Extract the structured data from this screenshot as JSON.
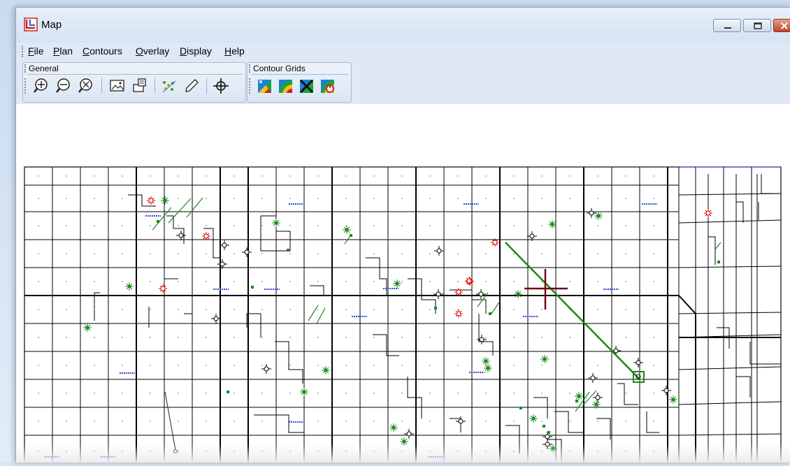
{
  "window": {
    "title": "Map"
  },
  "menu": [
    {
      "label": "File",
      "underline": "F",
      "rest": "ile"
    },
    {
      "label": "Plan",
      "underline": "P",
      "rest": "lan"
    },
    {
      "label": "Contours",
      "underline": "C",
      "rest": "ontours"
    },
    {
      "label": "Overlay",
      "underline": "O",
      "rest": "verlay"
    },
    {
      "label": "Display",
      "underline": "D",
      "rest": "isplay"
    },
    {
      "label": "Help",
      "underline": "H",
      "rest": "elp"
    }
  ],
  "toolbars": {
    "general": {
      "label": "General",
      "tools": [
        "zoom-in-icon",
        "zoom-out-icon",
        "zoom-reset-icon",
        "map-image-icon",
        "export-icon",
        "scatter-points-icon",
        "pencil-icon",
        "center-target-icon"
      ]
    },
    "contour_grids": {
      "label": "Contour Grids",
      "tools": [
        "grid-new-icon",
        "grid-contour-icon",
        "grid-delete-icon",
        "grid-refresh-icon"
      ]
    }
  },
  "colors": {
    "well_dry": "#000000",
    "well_gas": "#e00000",
    "well_oil": "#1a8a1a",
    "highlight": "#1a8a1a",
    "marker": "#6b0f0f",
    "section_lines": "#000000",
    "border": "#1c1caa",
    "labels": "#3050d0"
  }
}
